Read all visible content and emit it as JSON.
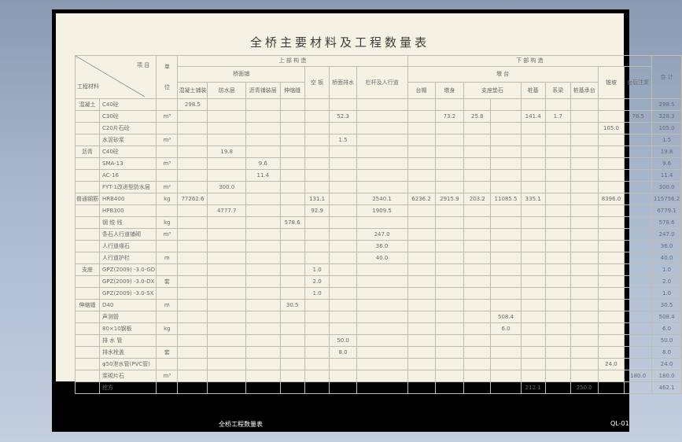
{
  "title": "全桥主要材料及工程数量表",
  "header": {
    "xiang_mu": "项 目",
    "gong_cheng_cai_liao": "工程材料",
    "dan": "单",
    "wei": "位",
    "shang_bu_jie_gou": "上 部 构 造",
    "qiao_mian_pu": "桥面铺",
    "xia_bu_gou_zao": "下 部 构 造",
    "dun_tai": "墩 台",
    "he_ji": "合 计",
    "sub": {
      "hun_ning_tu_pu_zhuang": "混凝土铺装",
      "fang_shui": "防水层",
      "li_qing_pu_zhuang": "沥青铺装层",
      "shen_suo_feng": "伸缩缝",
      "kong_ban": "空 板",
      "qiao_mian_pai_shui": "桥面排水",
      "lan_gan_ren_xing_dao": "栏杆及人行道",
      "tai_mao": "台帽",
      "dun_shen": "墩身",
      "zhi_zuo_dian_shi": "支座垫石",
      "zhuang_ji": "桩基",
      "xi_liang": "系梁",
      "zhui_po": "锥坡",
      "zhuang_ji_cheng_tai": "桩基承台",
      "tai_hou_zhu_jiang": "台后注浆"
    }
  },
  "rows": [
    {
      "grp": "混凝土",
      "name": "C40砼",
      "unit": "",
      "cells": {
        "c1": "298.5",
        "c17": "298.5"
      }
    },
    {
      "grp": "",
      "name": "C30砼",
      "unit": "m³",
      "cells": {
        "c6": "52.3",
        "c9": "73.2",
        "c10": "25.8",
        "c12": "141.4",
        "c13": "1.7",
        "c16": "78.5",
        "c17": "328.3"
      }
    },
    {
      "grp": "",
      "name": "C20片石砼",
      "unit": "",
      "cells": {
        "c15": "105.0",
        "c17": "105.0"
      }
    },
    {
      "grp": "",
      "name": "水泥砂浆",
      "unit": "m³",
      "cells": {
        "c6": "1.5",
        "c17": "1.5"
      }
    },
    {
      "grp": "沥青",
      "name": "C40砼",
      "unit": "",
      "cells": {
        "c2": "19.8",
        "c17": "19.8"
      }
    },
    {
      "grp": "",
      "name": "SMA-13",
      "unit": "m³",
      "cells": {
        "c3": "9.6",
        "c17": "9.6"
      }
    },
    {
      "grp": "",
      "name": "AC-16",
      "unit": "",
      "cells": {
        "c3": "11.4",
        "c17": "11.4"
      }
    },
    {
      "grp": "",
      "name": "FYT-1改进型防水层",
      "unit": "m²",
      "cells": {
        "c2": "300.0",
        "c17": "300.0"
      }
    },
    {
      "grp": "普通钢筋",
      "name": "HRB400",
      "unit": "kg",
      "cells": {
        "c1": "77262.6",
        "c5": "131.1",
        "c7": "2540.1",
        "c8": "6236.2",
        "c9": "2915.9",
        "c10": "203.2",
        "c11": "11085.5",
        "c12": "335.1",
        "c15": "8396.0",
        "c17": "115756.2"
      }
    },
    {
      "grp": "",
      "name": "HPB300",
      "unit": "",
      "cells": {
        "c2": "4777.7",
        "c5": "92.9",
        "c7": "1909.5",
        "c17": "6779.1"
      }
    },
    {
      "grp": "",
      "name": "钢 绞 线",
      "unit": "kg",
      "cells": {
        "c4": "578.6",
        "c17": "578.6"
      }
    },
    {
      "grp": "",
      "name": "条石人行道铺砌",
      "unit": "m³",
      "cells": {
        "c7": "247.0",
        "c17": "247.0"
      }
    },
    {
      "grp": "",
      "name": "人行道缘石",
      "unit": "",
      "cells": {
        "c7": "36.0",
        "c17": "36.0"
      }
    },
    {
      "grp": "",
      "name": "人行道护栏",
      "unit": "m",
      "cells": {
        "c7": "40.0",
        "c17": "40.0"
      }
    },
    {
      "grp": "支座",
      "name": "GPZ(2009) -3.0-GD",
      "unit": "",
      "cells": {
        "c5": "1.0",
        "c17": "1.0"
      }
    },
    {
      "grp": "",
      "name": "GPZ(2009) -3.0-DX",
      "unit": "套",
      "cells": {
        "c5": "2.0",
        "c17": "2.0"
      }
    },
    {
      "grp": "",
      "name": "GPZ(2009) -3.0-SX",
      "unit": "",
      "cells": {
        "c5": "1.0",
        "c17": "1.0"
      }
    },
    {
      "grp": "伸缩缝",
      "name": "D40",
      "unit": "m",
      "cells": {
        "c4": "30.5",
        "c17": "30.5"
      }
    },
    {
      "grp": "",
      "name": "声测管",
      "unit": "",
      "cells": {
        "c11": "508.4",
        "c17": "508.4"
      }
    },
    {
      "grp": "",
      "name": "80×10钢板",
      "unit": "kg",
      "cells": {
        "c11": "6.0",
        "c17": "6.0"
      }
    },
    {
      "grp": "",
      "name": "排 水 管",
      "unit": "",
      "cells": {
        "c6": "50.0",
        "c17": "50.0"
      }
    },
    {
      "grp": "",
      "name": "排水栓盖",
      "unit": "套",
      "cells": {
        "c6": "8.0",
        "c17": "8.0"
      }
    },
    {
      "grp": "",
      "name": "φ50泄水管(PVC管)",
      "unit": "",
      "cells": {
        "c15": "24.0",
        "c17": "24.0"
      }
    },
    {
      "grp": "",
      "name": "浆砌片石",
      "unit": "m³",
      "cells": {
        "c16": "180.0",
        "c17": "180.0"
      }
    },
    {
      "grp": "",
      "name": "挖方",
      "unit": "",
      "cells": {
        "c12": "212.1",
        "c14": "250.0",
        "c17": "462.1"
      }
    }
  ],
  "footer": {
    "drawing_name": "全桥工程数量表",
    "drawing_code": "QL-01"
  }
}
